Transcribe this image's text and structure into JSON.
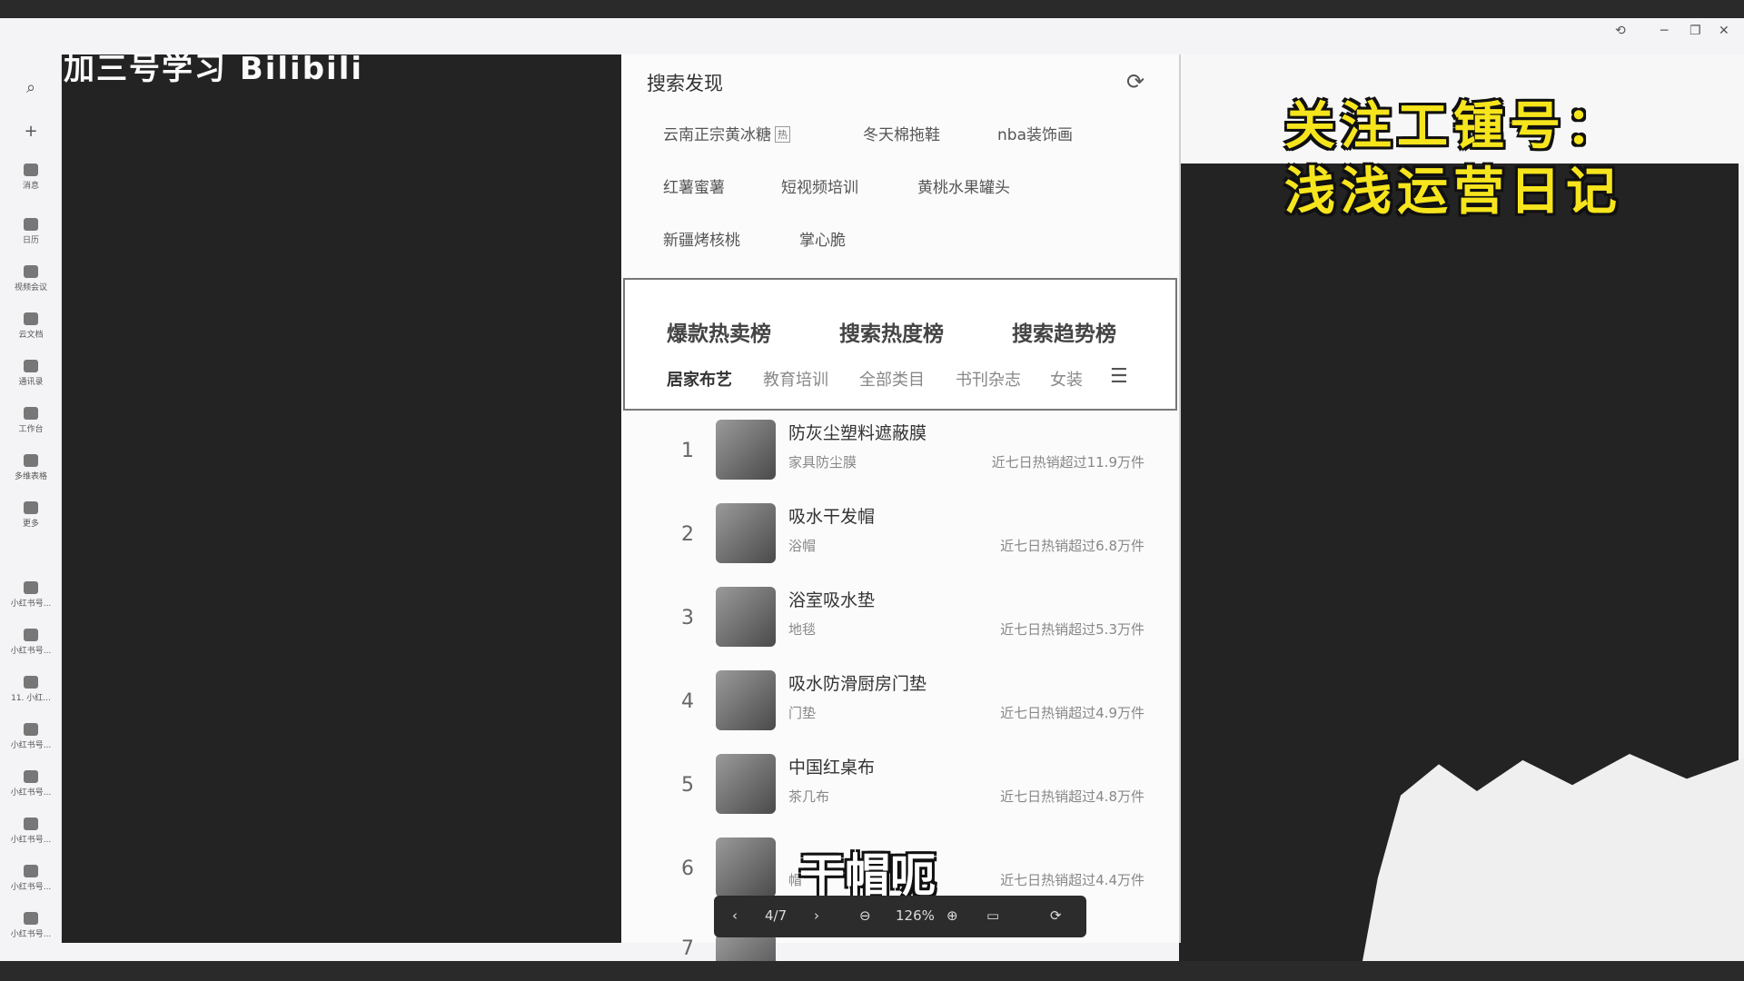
{
  "watermark": {
    "left_header": "加三号学习 Bilibili"
  },
  "sidebar": {
    "items": [
      {
        "label": "",
        "symbol": "⌕"
      },
      {
        "label": "",
        "symbol": "+"
      },
      {
        "label": "消息"
      },
      {
        "label": "日历"
      },
      {
        "label": "视频会议"
      },
      {
        "label": "云文档"
      },
      {
        "label": "通讯录"
      },
      {
        "label": "工作台"
      },
      {
        "label": "多维表格"
      },
      {
        "label": "更多"
      },
      {
        "label": "小红书号..."
      },
      {
        "label": "小红书号..."
      },
      {
        "label": "11. 小红..."
      },
      {
        "label": "小红书号..."
      },
      {
        "label": "小红书号..."
      },
      {
        "label": "小红书号..."
      },
      {
        "label": "小红书号..."
      },
      {
        "label": "小红书号..."
      }
    ]
  },
  "search_discovery": {
    "title": "搜索发现",
    "tags": [
      "云南正宗黄冰糖",
      "冬天棉拖鞋",
      "nba装饰画",
      "红薯蜜薯",
      "短视频培训",
      "黄桃水果罐头",
      "新疆烤核桃",
      "掌心脆"
    ],
    "hot_badge": "热"
  },
  "ranking": {
    "tabs": [
      "爆款热卖榜",
      "搜索热度榜",
      "搜索趋势榜"
    ],
    "categories": [
      "居家布艺",
      "教育培训",
      "全部类目",
      "书刊杂志",
      "女装"
    ],
    "items": [
      {
        "rank": "1",
        "name": "防灰尘塑料遮蔽膜",
        "sub": "家具防尘膜",
        "sales": "近七日热销超过11.9万件"
      },
      {
        "rank": "2",
        "name": "吸水干发帽",
        "sub": "浴帽",
        "sales": "近七日热销超过6.8万件"
      },
      {
        "rank": "3",
        "name": "浴室吸水垫",
        "sub": "地毯",
        "sales": "近七日热销超过5.3万件"
      },
      {
        "rank": "4",
        "name": "吸水防滑厨房门垫",
        "sub": "门垫",
        "sales": "近七日热销超过4.9万件"
      },
      {
        "rank": "5",
        "name": "中国红桌布",
        "sub": "茶几布",
        "sales": "近七日热销超过4.8万件"
      },
      {
        "rank": "6",
        "name": "",
        "sub": "帽",
        "sales": "近七日热销超过4.4万件"
      },
      {
        "rank": "7",
        "name": "",
        "sub": "",
        "sales": ""
      }
    ]
  },
  "overlay": {
    "line1": "关注工锺号：",
    "line2": "浅浅运营日记",
    "subtitle": "干帽呃"
  },
  "viewer": {
    "page": "4/7",
    "zoom": "126%"
  },
  "colors": {
    "overlay_yellow": "#f6e51c",
    "dark_panel": "#232323"
  }
}
